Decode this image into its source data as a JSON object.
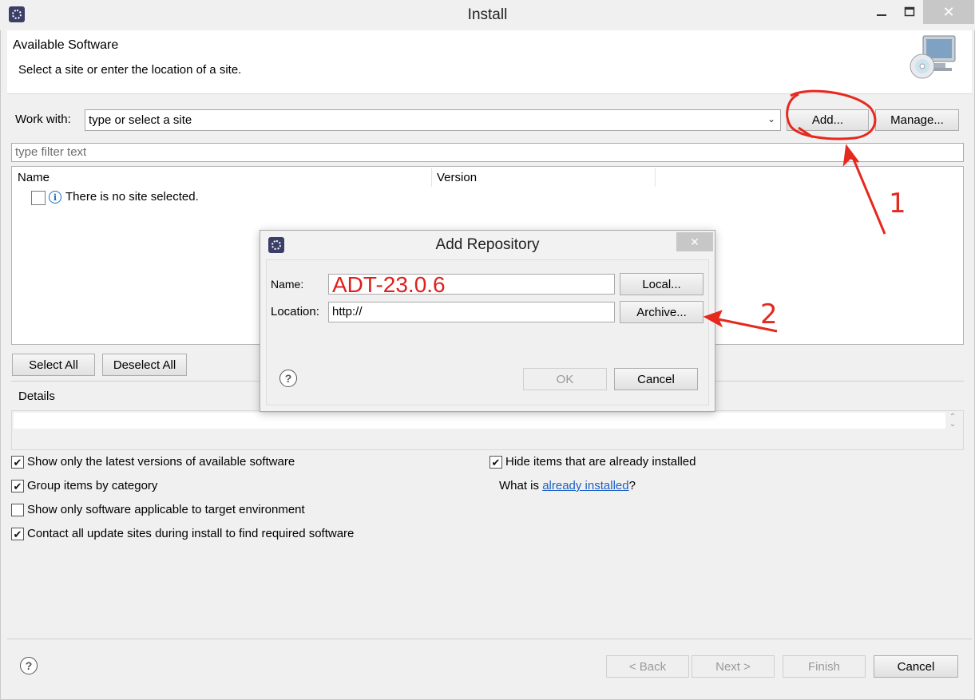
{
  "window": {
    "title": "Install",
    "icon": "eclipse-icon"
  },
  "banner": {
    "title": "Available Software",
    "description": "Select a site or enter the location of a site.",
    "graphic_icon": "monitor-cd-icon"
  },
  "work_with": {
    "label": "Work with:",
    "placeholder": "type or select a site",
    "add_label": "Add...",
    "manage_label": "Manage..."
  },
  "filter": {
    "placeholder": "type filter text"
  },
  "table": {
    "columns": [
      "Name",
      "Version"
    ],
    "rows": [
      {
        "text": "There is no site selected.",
        "checked": false,
        "icon": "info-icon"
      }
    ]
  },
  "selection_buttons": {
    "select_all": "Select All",
    "deselect_all": "Deselect All"
  },
  "details": {
    "label": "Details"
  },
  "options": {
    "left": [
      {
        "label": "Show only the latest versions of available software",
        "checked": true
      },
      {
        "label": "Group items by category",
        "checked": true
      },
      {
        "label": "Show only software applicable to target environment",
        "checked": false
      },
      {
        "label": "Contact all update sites during install to find required software",
        "checked": true
      }
    ],
    "right": [
      {
        "label": "Hide items that are already installed",
        "checked": true
      }
    ],
    "what_is_prefix": "What is ",
    "what_is_link": "already installed",
    "what_is_suffix": "?"
  },
  "footer": {
    "back": "< Back",
    "next": "Next >",
    "finish": "Finish",
    "cancel": "Cancel"
  },
  "dialog": {
    "title": "Add Repository",
    "name_label": "Name:",
    "name_value": "ADT-23.0.6",
    "location_label": "Location:",
    "location_value": "http://",
    "local_label": "Local...",
    "archive_label": "Archive...",
    "ok_label": "OK",
    "cancel_label": "Cancel"
  },
  "annotations": {
    "color": "#e5291f",
    "step1": "1",
    "step2": "2"
  }
}
